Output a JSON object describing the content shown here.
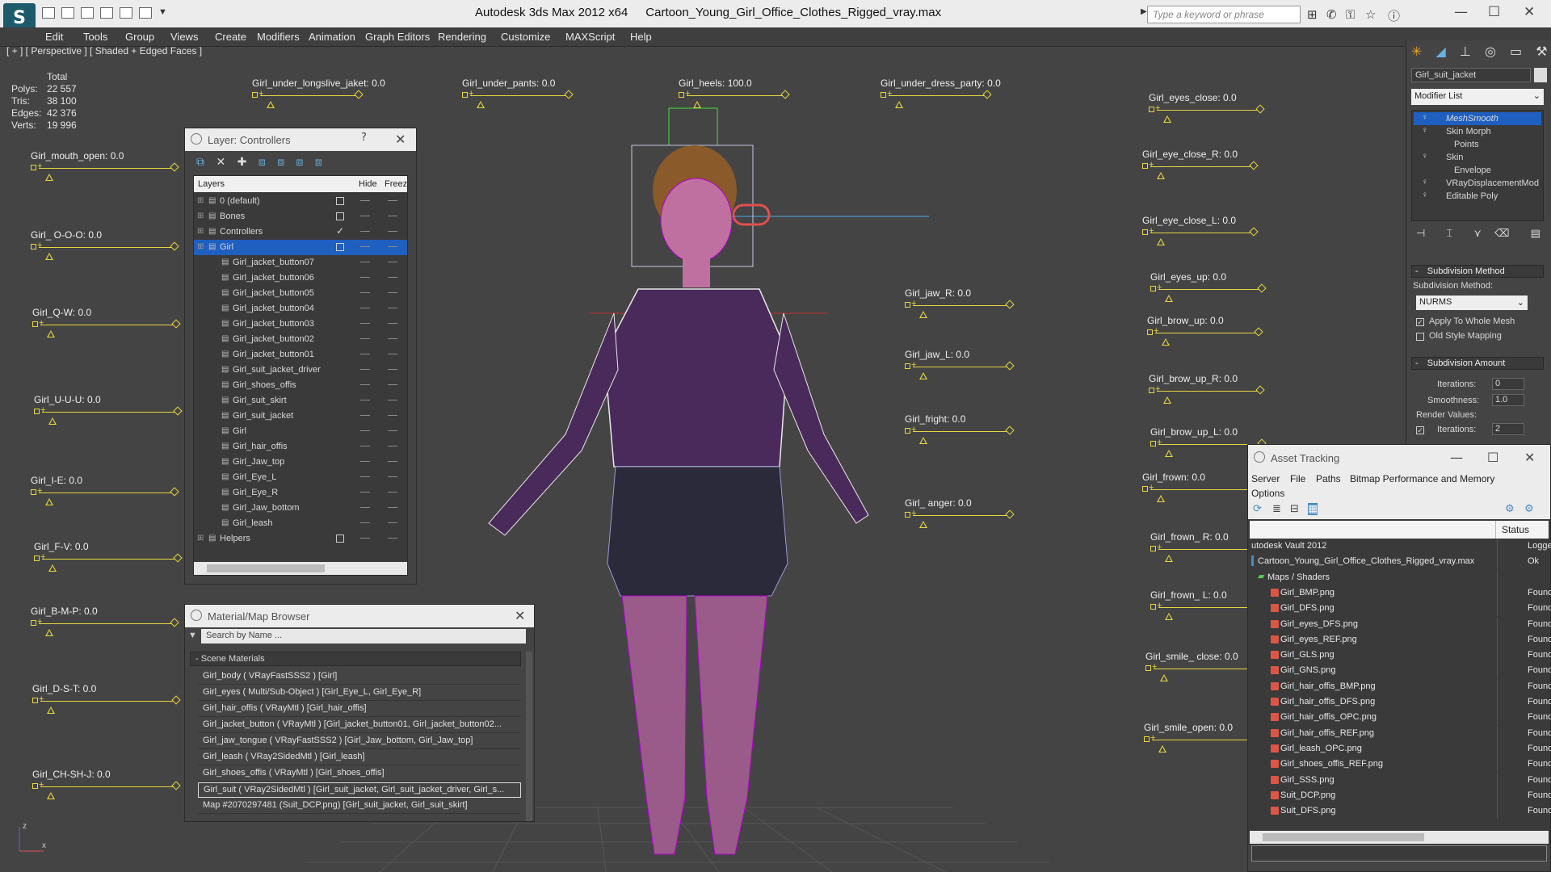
{
  "app": {
    "title": "Autodesk 3ds Max  2012 x64",
    "file": "Cartoon_Young_Girl_Office_Clothes_Rigged_vray.max",
    "search_placeholder": "Type a keyword or phrase",
    "logo": "S"
  },
  "menu": [
    "Edit",
    "Tools",
    "Group",
    "Views",
    "Create",
    "Modifiers",
    "Animation",
    "Graph Editors",
    "Rendering",
    "Customize",
    "MAXScript",
    "Help"
  ],
  "viewport": {
    "label": "[ + ] [ Perspective ] [ Shaded + Edged Faces ]",
    "stats": {
      "header": "Total",
      "rows": [
        [
          "Polys:",
          "22 557"
        ],
        [
          "Tris:",
          "38 100"
        ],
        [
          "Edges:",
          "42 376"
        ],
        [
          "Verts:",
          "19 996"
        ]
      ]
    }
  },
  "controls_left": [
    "Girl_mouth_open: 0.0",
    "Girl_ O-O-O: 0.0",
    "Girl_Q-W: 0.0",
    "Girl_U-U-U: 0.0",
    "Girl_I-E: 0.0",
    "Girl_F-V: 0.0",
    "Girl_B-M-P: 0.0",
    "Girl_D-S-T: 0.0",
    "Girl_CH-SH-J: 0.0"
  ],
  "controls_top": [
    "Girl_under_longslive_jaket: 0.0",
    "Girl_under_pants: 0.0",
    "Girl_heels: 100.0",
    "Girl_under_dress_party: 0.0"
  ],
  "controls_mid": [
    "Girl_jaw_R: 0.0",
    "Girl_jaw_L: 0.0",
    "Girl_fright: 0.0",
    "Girl_ anger: 0.0"
  ],
  "controls_right": [
    "Girl_eyes_close: 0.0",
    "Girl_eye_close_R: 0.0",
    "Girl_eye_close_L: 0.0",
    "Girl_eyes_up: 0.0",
    "Girl_brow_up: 0.0",
    "Girl_brow_up_R: 0.0",
    "Girl_brow_up_L: 0.0",
    "Girl_frown: 0.0",
    "Girl_frown_ R: 0.0",
    "Girl_frown_ L: 0.0",
    "Girl_smile_ close: 0.0",
    "Girl_smile_open: 0.0"
  ],
  "layers": {
    "title": "Layer: Controllers",
    "help": "?",
    "columns": [
      "Layers",
      "Hide",
      "Freeze"
    ],
    "rows": [
      {
        "name": "0 (default)",
        "level": 1,
        "cb": "box"
      },
      {
        "name": "Bones",
        "level": 1,
        "cb": "box"
      },
      {
        "name": "Controllers",
        "level": 1,
        "cb": "check"
      },
      {
        "name": "Girl",
        "level": 1,
        "cb": "box",
        "selected": true
      },
      {
        "name": "Girl_jacket_button07",
        "level": 2
      },
      {
        "name": "Girl_jacket_button06",
        "level": 2
      },
      {
        "name": "Girl_jacket_button05",
        "level": 2
      },
      {
        "name": "Girl_jacket_button04",
        "level": 2
      },
      {
        "name": "Girl_jacket_button03",
        "level": 2
      },
      {
        "name": "Girl_jacket_button02",
        "level": 2
      },
      {
        "name": "Girl_jacket_button01",
        "level": 2
      },
      {
        "name": "Girl_suit_jacket_driver",
        "level": 2
      },
      {
        "name": "Girl_shoes_offis",
        "level": 2
      },
      {
        "name": "Girl_suit_skirt",
        "level": 2
      },
      {
        "name": "Girl_suit_jacket",
        "level": 2
      },
      {
        "name": "Girl",
        "level": 2
      },
      {
        "name": "Girl_hair_offis",
        "level": 2
      },
      {
        "name": "Girl_Jaw_top",
        "level": 2
      },
      {
        "name": "Girl_Eye_L",
        "level": 2
      },
      {
        "name": "Girl_Eye_R",
        "level": 2
      },
      {
        "name": "Girl_Jaw_bottom",
        "level": 2
      },
      {
        "name": "Girl_leash",
        "level": 2
      },
      {
        "name": "Helpers",
        "level": 1,
        "cb": "box"
      }
    ]
  },
  "material_browser": {
    "title": "Material/Map Browser",
    "search_placeholder": "Search by Name ...",
    "section": "- Scene Materials",
    "rows": [
      "Girl_body  ( VRayFastSSS2 )  [Girl]",
      "Girl_eyes  ( Multi/Sub-Object )  [Girl_Eye_L, Girl_Eye_R]",
      "Girl_hair_offis  ( VRayMtl )  [Girl_hair_offis]",
      "Girl_jacket_button  ( VRayMtl )  [Girl_jacket_button01, Girl_jacket_button02...",
      "Girl_jaw_tongue  ( VRayFastSSS2 )  [Girl_Jaw_bottom, Girl_Jaw_top]",
      "Girl_leash  ( VRay2SidedMtl )  [Girl_leash]",
      "Girl_shoes_offis  ( VRayMtl )  [Girl_shoes_offis]",
      "Girl_suit  ( VRay2SidedMtl )  [Girl_suit_jacket, Girl_suit_jacket_driver, Girl_s...",
      "Map #2070297481 (Suit_DCP.png)  [Girl_suit_jacket, Girl_suit_skirt]"
    ]
  },
  "command_panel": {
    "object_name": "Girl_suit_jacket",
    "modifier_list": "Modifier List",
    "stack": [
      {
        "name": "MeshSmooth",
        "selected": true
      },
      {
        "name": "Skin Morph"
      },
      {
        "name": "Points",
        "sub": true
      },
      {
        "name": "Skin"
      },
      {
        "name": "Envelope",
        "sub": true
      },
      {
        "name": "VRayDisplacementMod"
      },
      {
        "name": "Editable Poly"
      }
    ],
    "rollout1": "Subdivision Method",
    "method_label": "Subdivision Method:",
    "method_value": "NURMS",
    "apply_whole": "Apply To Whole Mesh",
    "old_style": "Old Style Mapping",
    "rollout2": "Subdivision Amount",
    "iterations_label": "Iterations:",
    "iterations_value": "0",
    "smoothness_label": "Smoothness:",
    "smoothness_value": "1.0",
    "render_values": "Render Values:",
    "render_iter_label": "Iterations:",
    "render_iter_value": "2"
  },
  "asset_tracking": {
    "title": "Asset Tracking",
    "menu": [
      "Server",
      "File",
      "Paths",
      "Bitmap Performance and Memory",
      "Options"
    ],
    "status_header": "Status",
    "rows": [
      {
        "name": "utodesk Vault 2012",
        "status": "Logged O",
        "indent": 0
      },
      {
        "name": "Cartoon_Young_Girl_Office_Clothes_Rigged_vray.max",
        "status": "Ok",
        "indent": 1
      },
      {
        "name": "Maps / Shaders",
        "status": "",
        "indent": 2
      },
      {
        "name": "Girl_BMP.png",
        "status": "Found",
        "indent": 3
      },
      {
        "name": "Girl_DFS.png",
        "status": "Found",
        "indent": 3
      },
      {
        "name": "Girl_eyes_DFS.png",
        "status": "Found",
        "indent": 3
      },
      {
        "name": "Girl_eyes_REF.png",
        "status": "Found",
        "indent": 3
      },
      {
        "name": "Girl_GLS.png",
        "status": "Found",
        "indent": 3
      },
      {
        "name": "Girl_GNS.png",
        "status": "Found",
        "indent": 3
      },
      {
        "name": "Girl_hair_offis_BMP.png",
        "status": "Found",
        "indent": 3
      },
      {
        "name": "Girl_hair_offis_DFS.png",
        "status": "Found",
        "indent": 3
      },
      {
        "name": "Girl_hair_offis_OPC.png",
        "status": "Found",
        "indent": 3
      },
      {
        "name": "Girl_hair_offis_REF.png",
        "status": "Found",
        "indent": 3
      },
      {
        "name": "Girl_leash_OPC.png",
        "status": "Found",
        "indent": 3
      },
      {
        "name": "Girl_shoes_offis_REF.png",
        "status": "Found",
        "indent": 3
      },
      {
        "name": "Girl_SSS.png",
        "status": "Found",
        "indent": 3
      },
      {
        "name": "Suit_DCP.png",
        "status": "Found",
        "indent": 3
      },
      {
        "name": "Suit_DFS.png",
        "status": "Found",
        "indent": 3
      }
    ]
  },
  "axis": {
    "x": "x",
    "z": "z"
  },
  "colors": {
    "accent": "#e6d640",
    "selection": "#1f5fbf",
    "wire": "#b000d0"
  }
}
